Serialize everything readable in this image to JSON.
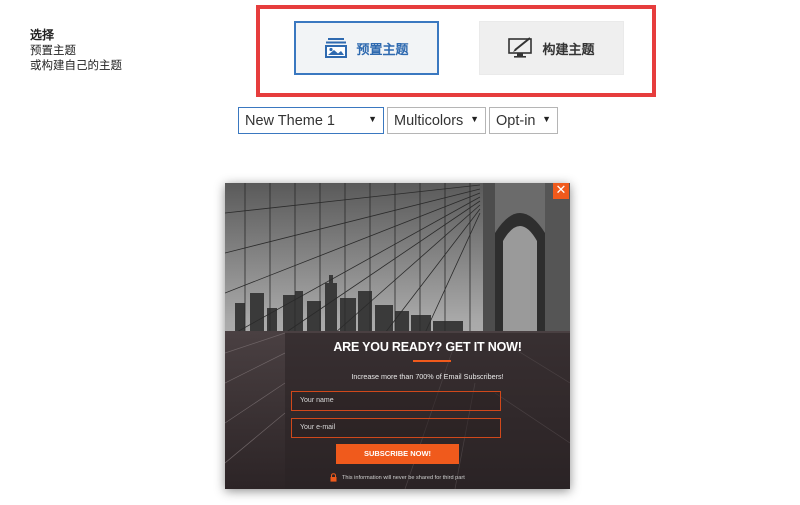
{
  "sidebar": {
    "title": "选择",
    "line1": "预置主题",
    "line2": "或构建自己的主题"
  },
  "mode_toggle": {
    "preset_label": "预置主题",
    "build_label": "构建主题"
  },
  "selectors": {
    "theme": "New Theme 1",
    "color": "Multicolors",
    "type": "Opt-in"
  },
  "preview": {
    "close_symbol": "✕",
    "headline": "ARE YOU READY?  GET IT NOW!",
    "subline": "Increase more than 700% of Email Subscribers!",
    "name_placeholder": "Your name",
    "email_placeholder": "Your e-mail",
    "submit_label": "SUBSCRIBE NOW!",
    "privacy_text": "This information will never be shared for third part"
  },
  "colors": {
    "accent_red": "#e63d3d",
    "accent_blue": "#3a78c0",
    "cta_orange": "#f05a1c"
  },
  "icons": {
    "preset": "image-stack-icon",
    "build": "monitor-pen-icon",
    "close": "close-icon",
    "privacy": "lock-icon"
  }
}
